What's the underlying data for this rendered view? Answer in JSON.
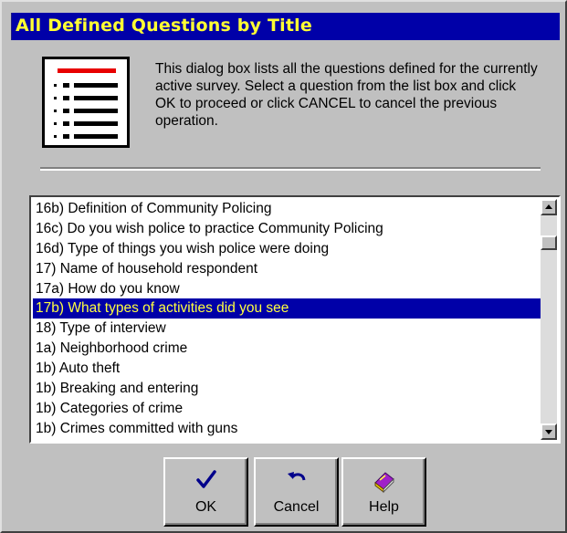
{
  "dialog": {
    "title": "All Defined Questions by Title",
    "description": "This dialog box lists all the questions defined for the currently active survey. Select a question from the list box and click OK to proceed or click CANCEL to cancel the previous operation."
  },
  "questions": {
    "items": [
      "16b) Definition of Community Policing",
      "16c) Do you wish police to practice Community Policing",
      "16d) Type of things you wish police were doing",
      "17) Name of household respondent",
      "17a) How do you know",
      "17b) What types of activities did you see",
      "18) Type of interview",
      "1a) Neighborhood crime",
      "1b) Auto theft",
      "1b) Breaking and entering",
      "1b) Categories of crime",
      "1b) Crimes committed with guns"
    ],
    "selected_index": 5
  },
  "buttons": {
    "ok": "OK",
    "cancel": "Cancel",
    "help": "Help"
  },
  "icons": {
    "document": "document-list-icon",
    "ok": "checkmark-icon",
    "cancel": "undo-arrow-icon",
    "help": "book-icon"
  },
  "colors": {
    "title_bg": "#0000a8",
    "title_text": "#ffff33",
    "selection_bg": "#0000a8",
    "selection_text": "#ffff40",
    "dialog_bg": "#c0c0c0"
  }
}
